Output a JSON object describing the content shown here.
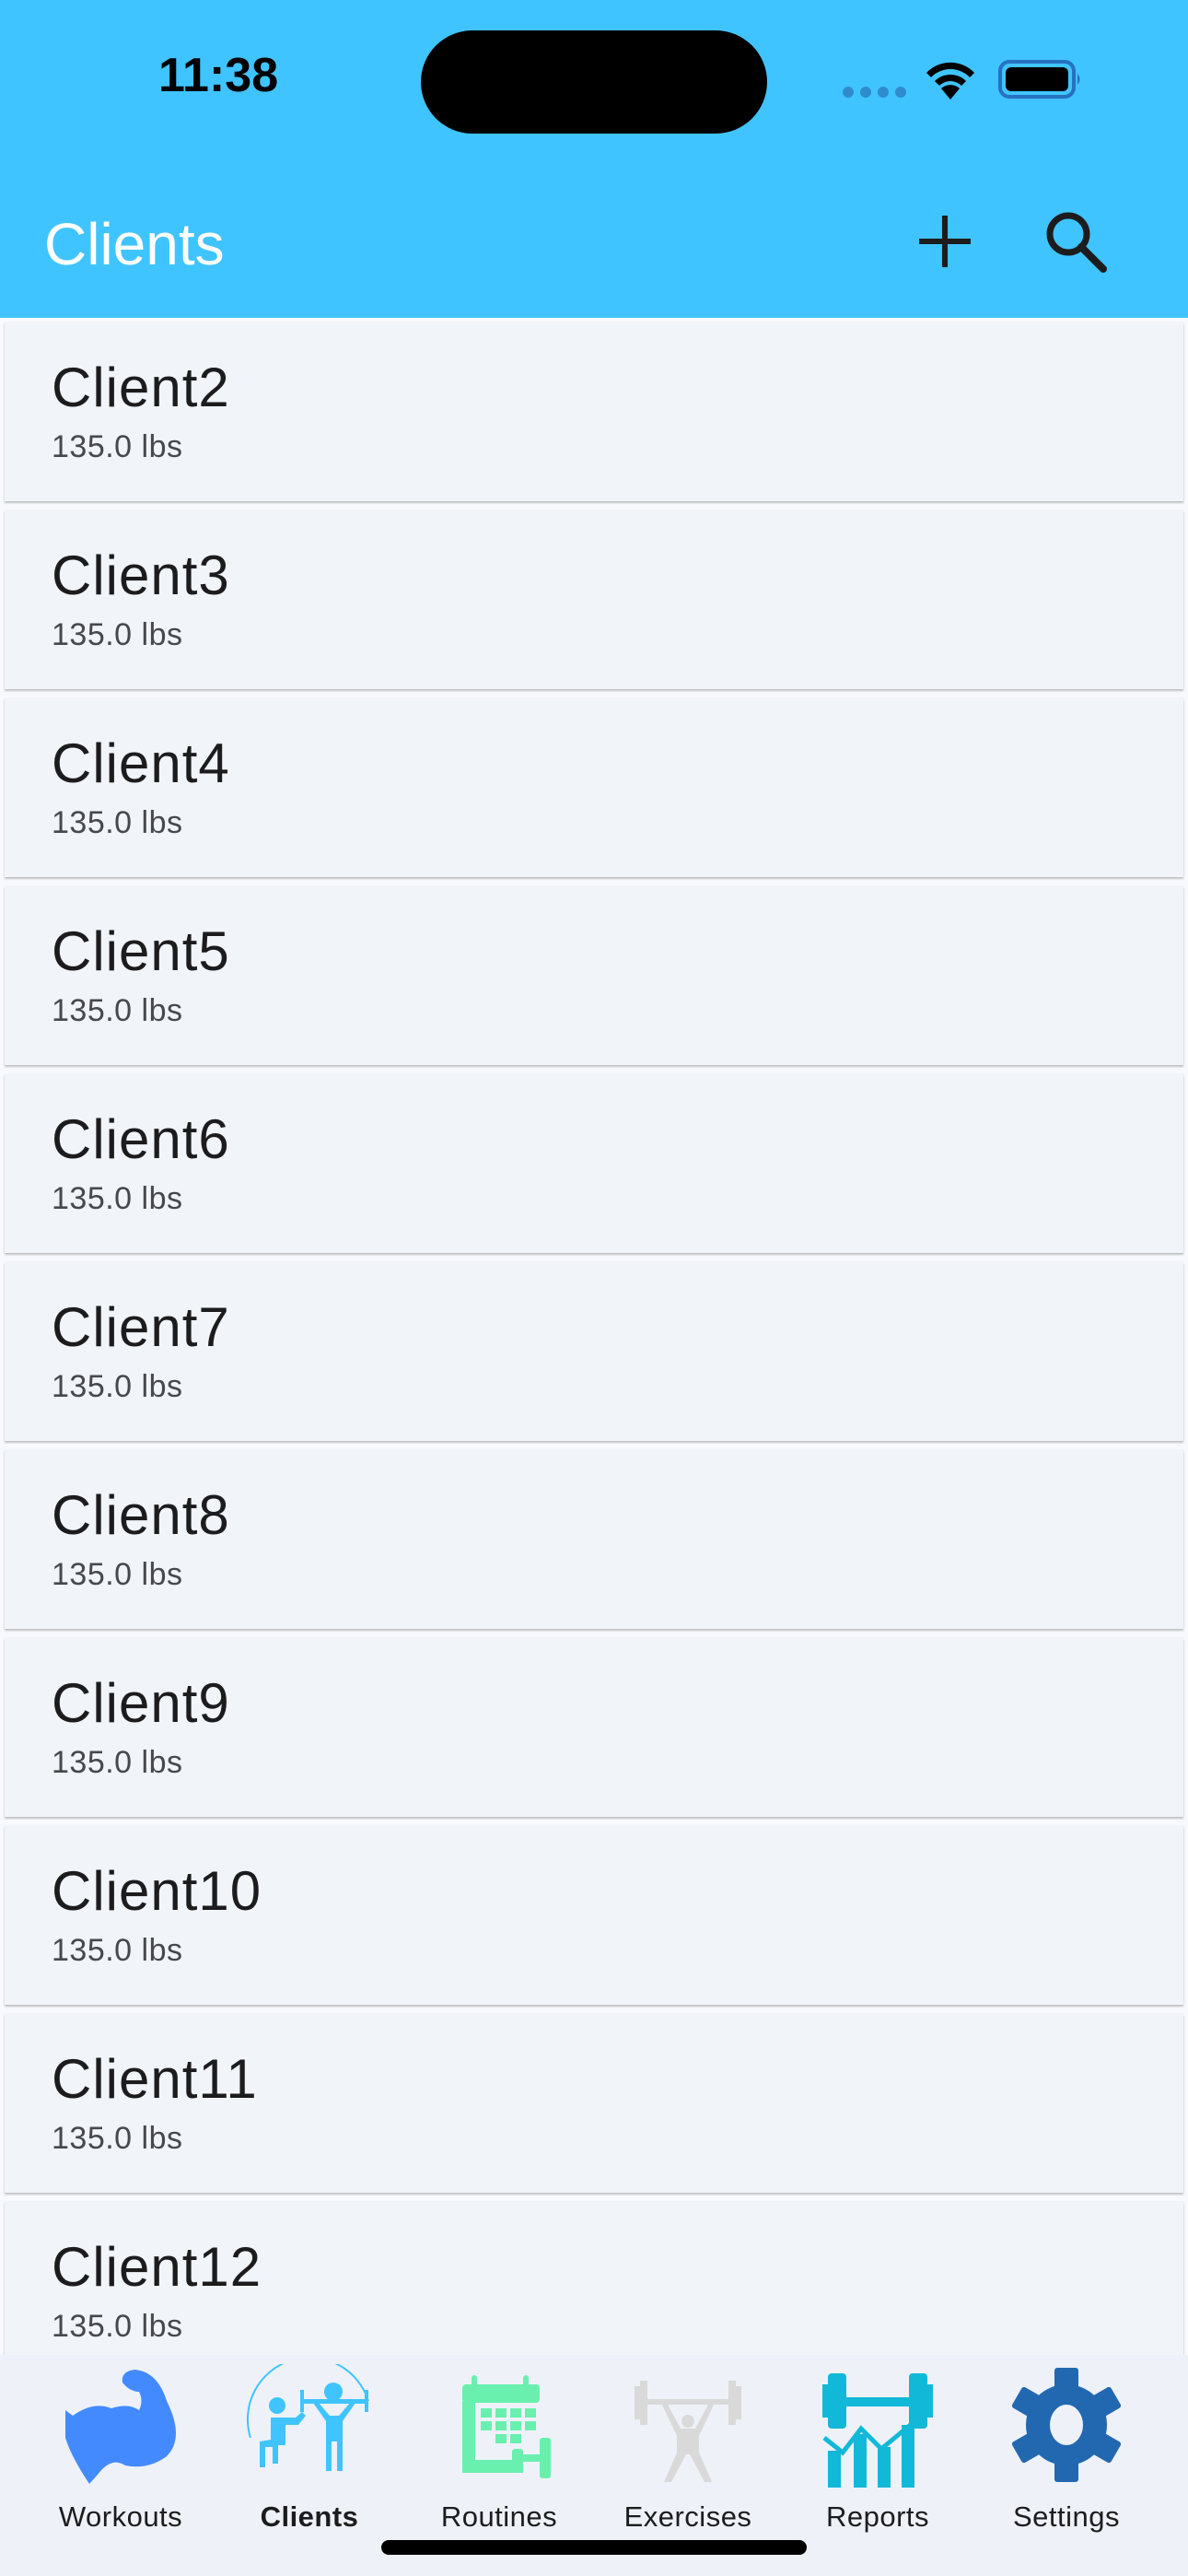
{
  "status_bar": {
    "time": "11:38"
  },
  "app_bar": {
    "title": "Clients",
    "actions": [
      {
        "name": "add",
        "icon": "plus-icon"
      },
      {
        "name": "search",
        "icon": "search-icon"
      }
    ]
  },
  "colors": {
    "app_bar": "#40C4FF",
    "title_text": "#FFFFFF",
    "card_bg": "#F1F4F9",
    "nav_bg": "#EEF2F8",
    "workouts_icon": "#448AFF",
    "clients_icon": "#40C4FF",
    "routines_icon": "#69F0AE",
    "exercises_icon": "#D9D9D9",
    "reports_icon": "#12B8D8",
    "settings_icon": "#2268B0"
  },
  "clients": [
    {
      "name": "Client2",
      "weight": "135.0 lbs"
    },
    {
      "name": "Client3",
      "weight": "135.0 lbs"
    },
    {
      "name": "Client4",
      "weight": "135.0 lbs"
    },
    {
      "name": "Client5",
      "weight": "135.0 lbs"
    },
    {
      "name": "Client6",
      "weight": "135.0 lbs"
    },
    {
      "name": "Client7",
      "weight": "135.0 lbs"
    },
    {
      "name": "Client8",
      "weight": "135.0 lbs"
    },
    {
      "name": "Client9",
      "weight": "135.0 lbs"
    },
    {
      "name": "Client10",
      "weight": "135.0 lbs"
    },
    {
      "name": "Client11",
      "weight": "135.0 lbs"
    },
    {
      "name": "Client12",
      "weight": "135.0 lbs"
    }
  ],
  "bottom_nav": {
    "active": "Clients",
    "items": [
      {
        "label": "Workouts",
        "icon": "flexed-bicep-icon"
      },
      {
        "label": "Clients",
        "icon": "trainer-client-icon"
      },
      {
        "label": "Routines",
        "icon": "calendar-dumbbell-icon"
      },
      {
        "label": "Exercises",
        "icon": "weightlifter-icon"
      },
      {
        "label": "Reports",
        "icon": "dumbbell-chart-icon"
      },
      {
        "label": "Settings",
        "icon": "gear-icon"
      }
    ]
  }
}
